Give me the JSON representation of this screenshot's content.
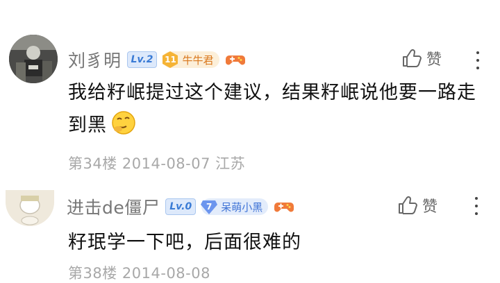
{
  "comments": [
    {
      "username": "刘豸明",
      "level": "Lv.2",
      "honor_level": "11",
      "honor_title": "牛牛君",
      "like_label": "赞",
      "text": "我给籽岷提过这个建议，结果籽岷说他要一路走到黑",
      "floor": "第34楼",
      "date": "2014-08-07",
      "location": "江苏"
    },
    {
      "username": "进击de僵尸",
      "level": "Lv.0",
      "honor_level": "7",
      "honor_title": "呆萌小黑",
      "like_label": "赞",
      "text": "籽珉学一下吧，后面很难的",
      "floor": "第38楼",
      "date": "2014-08-08"
    }
  ],
  "colors": {
    "gold_badge": "#f5b335",
    "blue_badge": "#6c95ee",
    "level_badge": "#3a7bd5"
  },
  "icons": [
    "thumbs-up-icon",
    "more-vertical-icon",
    "gamepad-icon",
    "thinking-emoji"
  ]
}
